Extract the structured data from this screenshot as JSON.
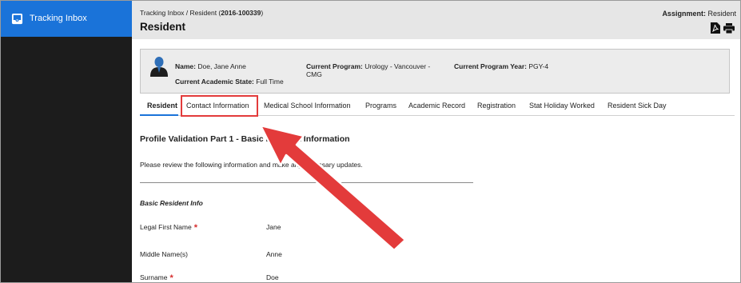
{
  "sidebar": {
    "items": [
      {
        "label": "Tracking Inbox",
        "icon": "inbox-icon",
        "active": true
      }
    ]
  },
  "header": {
    "breadcrumb_prefix": "Tracking Inbox / Resident (",
    "breadcrumb_id": "2016-100339",
    "breadcrumb_suffix": ")",
    "title": "Resident",
    "assignment_label": "Assignment:",
    "assignment_value": "Resident",
    "actions": [
      {
        "icon": "pdf-icon"
      },
      {
        "icon": "print-icon"
      }
    ]
  },
  "profile": {
    "name_label": "Name:",
    "name_value": "Doe, Jane Anne",
    "state_label": "Current Academic State:",
    "state_value": "Full Time",
    "program_label": "Current Program:",
    "program_value": "Urology - Vancouver - CMG",
    "year_label": "Current Program Year:",
    "year_value": "PGY-4"
  },
  "tabs": [
    {
      "label": "Resident",
      "active": true
    },
    {
      "label": "Contact Information",
      "highlighted": true
    },
    {
      "label": "Medical School Information"
    },
    {
      "label": "Programs"
    },
    {
      "label": "Academic Record"
    },
    {
      "label": "Registration"
    },
    {
      "label": "Stat Holiday Worked"
    },
    {
      "label": "Resident Sick Day"
    }
  ],
  "content": {
    "section_title": "Profile Validation Part 1 - Basic Resident Information",
    "section_desc": "Please review the following information and make any necessary updates.",
    "subsection_title": "Basic Resident Info",
    "fields": [
      {
        "label": "Legal First Name",
        "required": true,
        "value": "Jane"
      },
      {
        "label": "Middle Name(s)",
        "required": false,
        "value": "Anne"
      },
      {
        "label": "Surname",
        "required": true,
        "value": "Doe"
      }
    ]
  },
  "colors": {
    "sidebar_bg": "#1c1c1c",
    "accent": "#1a73d9",
    "annotation": "#e33b3b",
    "required": "#d62d2d"
  }
}
